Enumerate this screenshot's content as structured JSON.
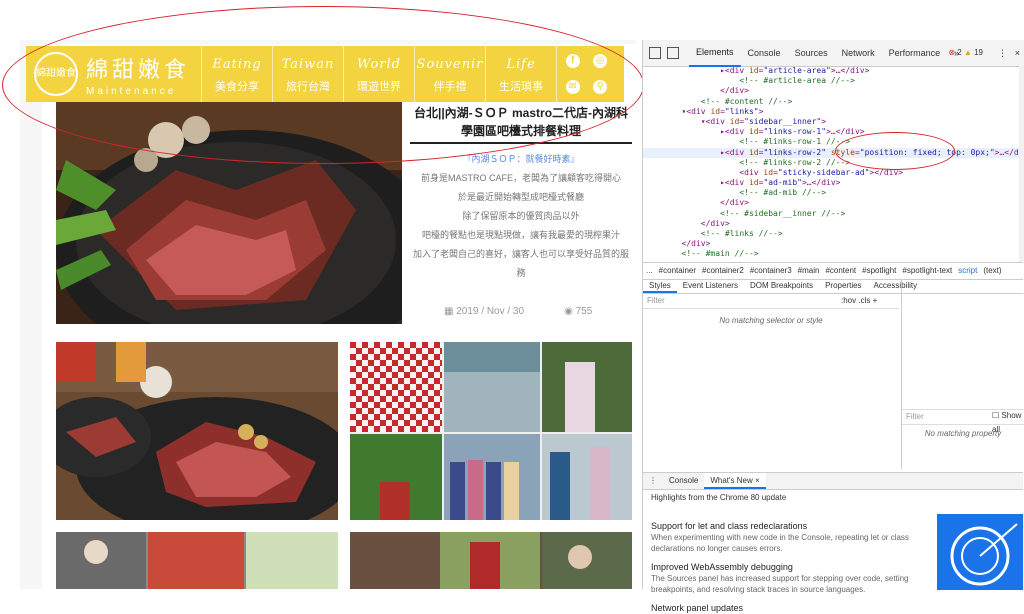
{
  "site": {
    "logo_title": "綿甜嫩食",
    "logo_sub": "Maintenance",
    "logo_badge": "綿甜嫩食",
    "nav": [
      {
        "en": "Eating",
        "zh": "美食分享"
      },
      {
        "en": "Taiwan",
        "zh": "旅行台灣"
      },
      {
        "en": "World",
        "zh": "環遊世界"
      },
      {
        "en": "Souvenir",
        "zh": "伴手禮"
      },
      {
        "en": "Life",
        "zh": "生活瑣事"
      }
    ],
    "social_icons": [
      "facebook-icon",
      "instagram-icon",
      "mail-icon",
      "search-icon"
    ]
  },
  "article": {
    "title": "台北||內湖-ＳＯＰ mastro二代店-內湖科學園區吧檯式排餐料理",
    "lines": [
      "『內湖ＳＯＰ：就餐好時素』",
      "前身是MASTRO CAFE，老闆為了讓顧客吃得開心",
      "於是最近開始轉型成吧檯式餐廳",
      "除了保留原本的優質肉品以外",
      "吧檯的餐點也是現點現做，讓有我最愛的現榨果汁",
      "加入了老闆自己的喜好，讓客人也可以享受好品質的服務"
    ],
    "date": "2019 / Nov / 30",
    "views": "755"
  },
  "devtools": {
    "tabs": [
      "Elements",
      "Console",
      "Sources",
      "Network",
      "Performance",
      "»"
    ],
    "errors": "2",
    "warnings": "19",
    "code": [
      {
        "indent": 8,
        "parts": [
          [
            "tag",
            "▸<div "
          ],
          [
            "attr",
            "id"
          ],
          [
            "tag",
            "="
          ],
          [
            "val",
            "\"article-area\""
          ],
          [
            "tag",
            ">…</div>"
          ]
        ]
      },
      {
        "indent": 10,
        "parts": [
          [
            "cmt",
            "<!-- #article-area //-->"
          ]
        ]
      },
      {
        "indent": 8,
        "parts": [
          [
            "tag",
            "</div>"
          ]
        ]
      },
      {
        "indent": 6,
        "parts": [
          [
            "cmt",
            "<!-- #content //-->"
          ]
        ]
      },
      {
        "indent": 4,
        "parts": [
          [
            "tag",
            "▾<div "
          ],
          [
            "attr",
            "id"
          ],
          [
            "tag",
            "="
          ],
          [
            "val",
            "\"links\""
          ],
          [
            "tag",
            ">"
          ]
        ]
      },
      {
        "indent": 6,
        "parts": [
          [
            "tag",
            "▾<div "
          ],
          [
            "attr",
            "id"
          ],
          [
            "tag",
            "="
          ],
          [
            "val",
            "\"sidebar__inner\""
          ],
          [
            "tag",
            ">"
          ]
        ]
      },
      {
        "indent": 8,
        "parts": [
          [
            "tag",
            "▸<div "
          ],
          [
            "attr",
            "id"
          ],
          [
            "tag",
            "="
          ],
          [
            "val",
            "\"links-row-1\""
          ],
          [
            "tag",
            ">…</div>"
          ]
        ]
      },
      {
        "indent": 10,
        "parts": [
          [
            "cmt",
            "<!-- #links-row-1 //-->"
          ]
        ]
      },
      {
        "indent": 8,
        "parts": [
          [
            "tag",
            "▸<div "
          ],
          [
            "attr",
            "id"
          ],
          [
            "tag",
            "="
          ],
          [
            "val",
            "\"links-row-2\""
          ],
          [
            "attr",
            " style"
          ],
          [
            "tag",
            "="
          ],
          [
            "val",
            "\"position: fixed; top: 0px;\""
          ],
          [
            "tag",
            ">…</div>"
          ]
        ]
      },
      {
        "indent": 10,
        "parts": [
          [
            "cmt",
            "<!-- #links-row-2 //-->"
          ]
        ]
      },
      {
        "indent": 10,
        "parts": [
          [
            "tag",
            "<div "
          ],
          [
            "attr",
            "id"
          ],
          [
            "tag",
            "="
          ],
          [
            "val",
            "\"sticky-sidebar-ad\""
          ],
          [
            "tag",
            "></div>"
          ]
        ]
      },
      {
        "indent": 8,
        "parts": [
          [
            "tag",
            "▸<div "
          ],
          [
            "attr",
            "id"
          ],
          [
            "tag",
            "="
          ],
          [
            "val",
            "\"ad-mib\""
          ],
          [
            "tag",
            ">…</div>"
          ]
        ]
      },
      {
        "indent": 10,
        "parts": [
          [
            "cmt",
            "<!-- #ad-mib //-->"
          ]
        ]
      },
      {
        "indent": 8,
        "parts": [
          [
            "tag",
            "</div>"
          ]
        ]
      },
      {
        "indent": 8,
        "parts": [
          [
            "cmt",
            "<!-- #sidebar__inner //-->"
          ]
        ]
      },
      {
        "indent": 6,
        "parts": [
          [
            "tag",
            "</div>"
          ]
        ]
      },
      {
        "indent": 6,
        "parts": [
          [
            "cmt",
            "<!-- #links //-->"
          ]
        ]
      },
      {
        "indent": 4,
        "parts": [
          [
            "tag",
            "</div>"
          ]
        ]
      },
      {
        "indent": 4,
        "parts": [
          [
            "cmt",
            "<!-- #main //-->"
          ]
        ]
      }
    ],
    "breadcrumbs": [
      "...",
      "#container",
      "#container2",
      "#container3",
      "#main",
      "#content",
      "#spotlight",
      "#spotlight-text",
      "script",
      "(text)"
    ],
    "panel_tabs": [
      "Styles",
      "Event Listeners",
      "DOM Breakpoints",
      "Properties",
      "Accessibility"
    ],
    "filter_placeholder": "Filter",
    "filter_controls": ":hov  .cls  +",
    "no_matching_selector": "No matching selector or style",
    "filter2": "Filter",
    "show_all": "Show all",
    "no_matching_property": "No matching property",
    "drawer_tabs": [
      "Console",
      "What's New ×"
    ],
    "whats_new_head": "Highlights from the Chrome 80 update",
    "whats_new": [
      {
        "title": "Support for let and class redeclarations",
        "desc": "When experimenting with new code in the Console, repeating let or class declarations no longer causes errors."
      },
      {
        "title": "Improved WebAssembly debugging",
        "desc": "The Sources panel has increased support for stepping over code, setting breakpoints, and resolving stack traces in source languages."
      },
      {
        "title": "Network panel updates",
        "desc": ""
      }
    ]
  }
}
